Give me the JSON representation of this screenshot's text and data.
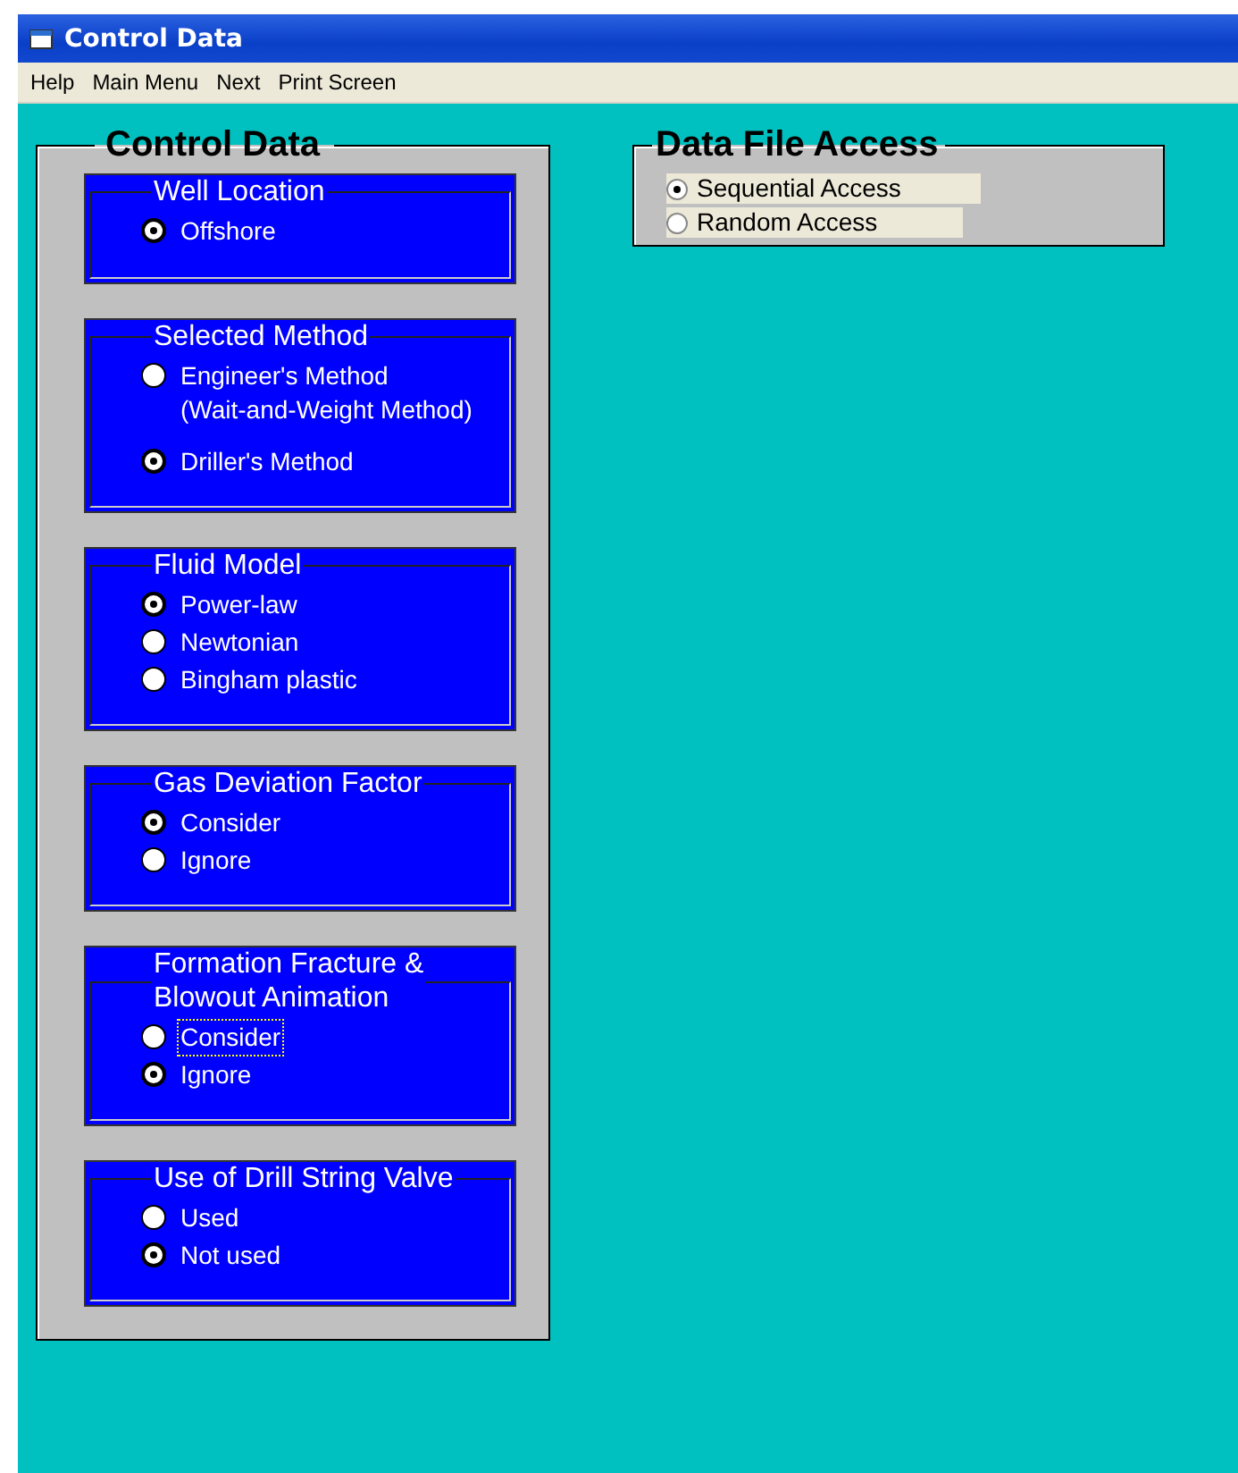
{
  "window": {
    "title": "Control Data"
  },
  "menu": [
    "Help",
    "Main Menu",
    "Next",
    "Print Screen"
  ],
  "control_panel": {
    "title": "Control Data",
    "groups": [
      {
        "title": "Well Location",
        "options": [
          {
            "label": "Offshore",
            "selected": true,
            "focused": false
          }
        ]
      },
      {
        "title": "Selected Method",
        "options": [
          {
            "label": "Engineer's Method\n(Wait-and-Weight Method)",
            "selected": false,
            "focused": false
          },
          {
            "label": "Driller's Method",
            "selected": true,
            "focused": false
          }
        ]
      },
      {
        "title": "Fluid Model",
        "options": [
          {
            "label": "Power-law",
            "selected": true,
            "focused": false
          },
          {
            "label": "Newtonian",
            "selected": false,
            "focused": false
          },
          {
            "label": "Bingham plastic",
            "selected": false,
            "focused": false
          }
        ]
      },
      {
        "title": "Gas Deviation Factor",
        "options": [
          {
            "label": "Consider",
            "selected": true,
            "focused": false
          },
          {
            "label": "Ignore",
            "selected": false,
            "focused": false
          }
        ]
      },
      {
        "title": "Formation Fracture &\nBlowout Animation",
        "options": [
          {
            "label": "Consider",
            "selected": false,
            "focused": true
          },
          {
            "label": "Ignore",
            "selected": true,
            "focused": false
          }
        ]
      },
      {
        "title": "Use of Drill String Valve",
        "options": [
          {
            "label": "Used",
            "selected": false,
            "focused": false
          },
          {
            "label": "Not used",
            "selected": true,
            "focused": false
          }
        ]
      }
    ]
  },
  "file_access": {
    "title": "Data File Access",
    "options": [
      {
        "label": "Sequential Access",
        "selected": true
      },
      {
        "label": "Random Access",
        "selected": false
      }
    ]
  }
}
